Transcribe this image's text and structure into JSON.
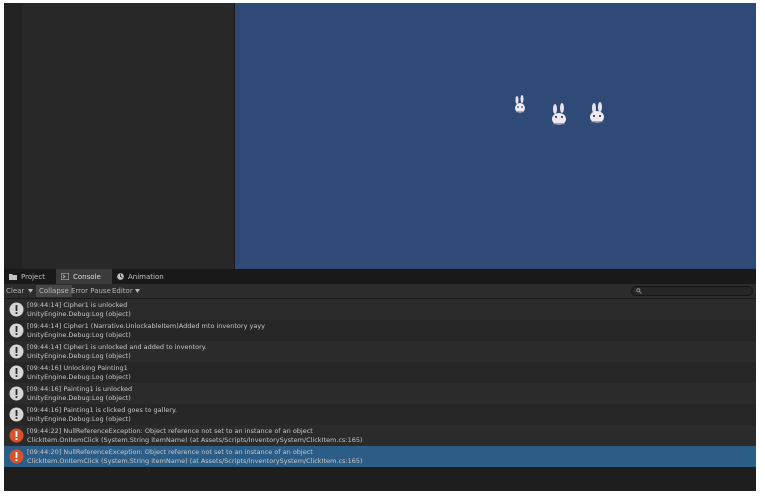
{
  "tabs": [
    {
      "label": "Project",
      "icon": "folder-icon"
    },
    {
      "label": "Console",
      "icon": "console-icon"
    },
    {
      "label": "Animation",
      "icon": "animation-icon"
    }
  ],
  "toolbar": {
    "clear": "Clear",
    "collapse": "Collapse",
    "error_pause": "Error Pause",
    "editor": "Editor"
  },
  "logs": [
    {
      "type": "info",
      "line1": "[09:44:14] Cipher1 is unlocked",
      "line2": "UnityEngine.Debug:Log (object)"
    },
    {
      "type": "info",
      "line1": "[09:44:14] Cipher1 (Narrative.UnlockableItem)Added mto inventory yayy",
      "line2": "UnityEngine.Debug:Log (object)"
    },
    {
      "type": "info",
      "line1": "[09:44:14] Cipher1 is unlocked and added to inventory.",
      "line2": "UnityEngine.Debug:Log (object)"
    },
    {
      "type": "info",
      "line1": "[09:44:16] Unlocking Painting1",
      "line2": "UnityEngine.Debug:Log (object)"
    },
    {
      "type": "info",
      "line1": "[09:44:16] Painting1 is unlocked",
      "line2": "UnityEngine.Debug:Log (object)"
    },
    {
      "type": "info",
      "line1": "[09:44:16] Painting1 is clicked goes to gallery.",
      "line2": "UnityEngine.Debug:Log (object)"
    },
    {
      "type": "error",
      "line1": "[09:44:22] NullReferenceException: Object reference not set to an instance of an object",
      "line2": "ClickItem.OnItemClick (System.String itemName) (at Assets/Scripts/InventorySystem/ClickItem.cs:165)"
    },
    {
      "type": "error",
      "line1": "[09:44:20] NullReferenceException: Object reference not set to an instance of an object",
      "line2": "ClickItem.OnItemClick (System.String itemName) (at Assets/Scripts/InventorySystem/ClickItem.cs:165)",
      "selected": true
    }
  ],
  "colors": {
    "scene_background": "#304a78",
    "selected_row": "#2c5d87",
    "error_icon": "#d9522b",
    "info_icon": "#d6d6d6"
  }
}
